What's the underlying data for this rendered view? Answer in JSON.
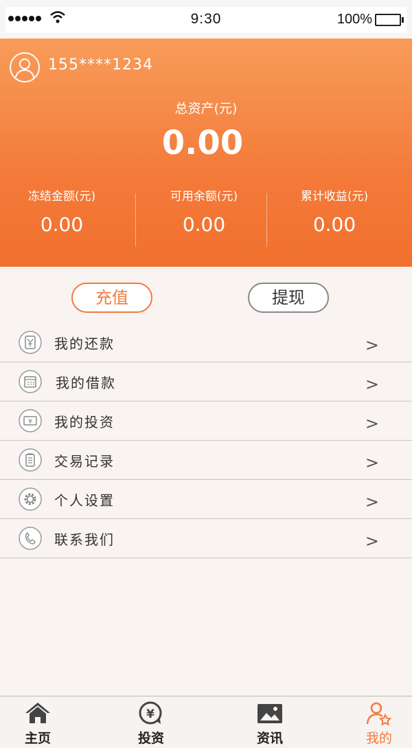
{
  "status_bar": {
    "time": "9:30",
    "battery": "100%"
  },
  "account": {
    "phone": "155****1234",
    "total_label": "总资产(元)",
    "total_value": "0.00",
    "stats": [
      {
        "label": "冻结金额(元)",
        "value": "0.00"
      },
      {
        "label": "可用余额(元)",
        "value": "0.00"
      },
      {
        "label": "累计收益(元)",
        "value": "0.00"
      }
    ]
  },
  "actions": {
    "recharge": "充值",
    "withdraw": "提现"
  },
  "menu": [
    {
      "label": "我的还款",
      "icon": "repayment-icon",
      "arrow": ">"
    },
    {
      "label": "我的借款",
      "icon": "calendar-icon",
      "arrow": ">"
    },
    {
      "label": "我的投资",
      "icon": "money-icon",
      "arrow": ">"
    },
    {
      "label": "交易记录",
      "icon": "clipboard-icon",
      "arrow": ">"
    },
    {
      "label": "个人设置",
      "icon": "gear-icon",
      "arrow": ">"
    },
    {
      "label": "联系我们",
      "icon": "phone-icon",
      "arrow": ">"
    }
  ],
  "tabs": [
    {
      "label": "主页",
      "icon": "home-icon"
    },
    {
      "label": "投资",
      "icon": "yuan-icon"
    },
    {
      "label": "资讯",
      "icon": "image-icon"
    },
    {
      "label": "我的",
      "icon": "user-star-icon",
      "active": true
    }
  ],
  "colors": {
    "accent": "#f47a3a",
    "header_top": "#f89c59",
    "header_bottom": "#f1702d"
  }
}
